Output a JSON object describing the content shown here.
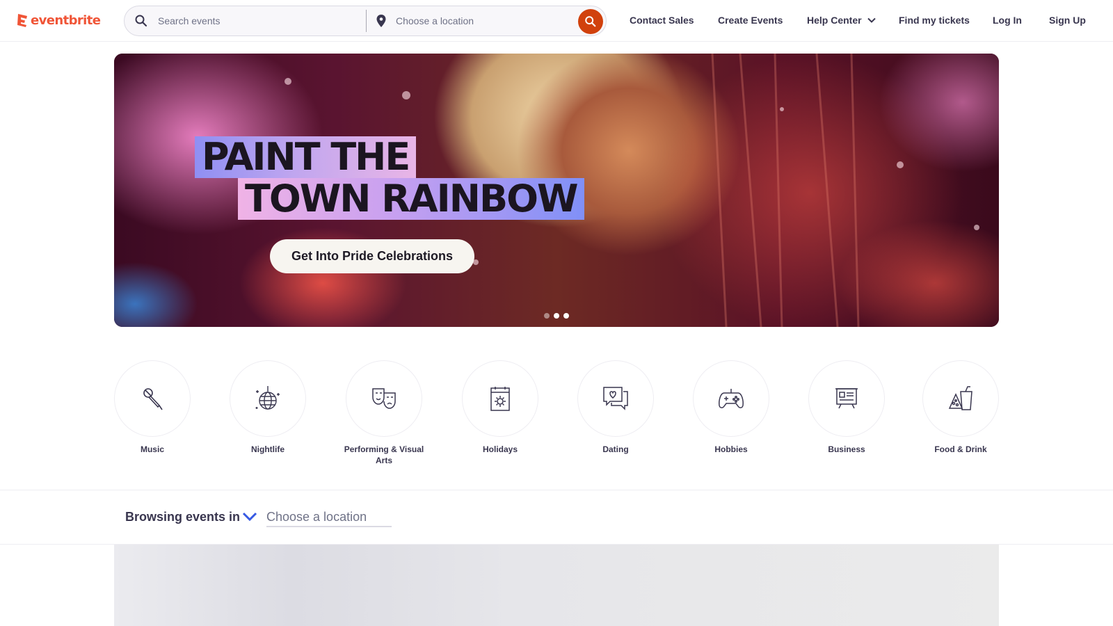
{
  "header": {
    "logo_text": "eventbrite",
    "search": {
      "placeholder": "Search events",
      "value": ""
    },
    "location": {
      "placeholder": "Choose a location",
      "value": ""
    },
    "nav": {
      "contact_sales": "Contact Sales",
      "create_events": "Create Events",
      "help_center": "Help Center",
      "find_tickets": "Find my tickets",
      "log_in": "Log In",
      "sign_up": "Sign Up"
    }
  },
  "hero": {
    "title_line_1": "PAINT THE",
    "title_line_2": "TOWN RAINBOW",
    "cta_label": "Get Into Pride Celebrations",
    "carousel_slide_count": 3,
    "carousel_active_index": 1
  },
  "categories": [
    {
      "label": "Music",
      "icon": "microphone-icon"
    },
    {
      "label": "Nightlife",
      "icon": "disco-ball-icon"
    },
    {
      "label": "Performing & Visual Arts",
      "icon": "theater-masks-icon"
    },
    {
      "label": "Holidays",
      "icon": "calendar-icon"
    },
    {
      "label": "Dating",
      "icon": "chat-heart-icon"
    },
    {
      "label": "Hobbies",
      "icon": "gamepad-icon"
    },
    {
      "label": "Business",
      "icon": "presentation-board-icon"
    },
    {
      "label": "Food & Drink",
      "icon": "food-drink-icon"
    }
  ],
  "browse": {
    "label": "Browsing events in",
    "location_placeholder": "Choose a location",
    "location_value": ""
  },
  "colors": {
    "brand": "#f05537",
    "search_button": "#d1410c",
    "text_primary": "#39364f",
    "accent_blue": "#3659e3"
  }
}
